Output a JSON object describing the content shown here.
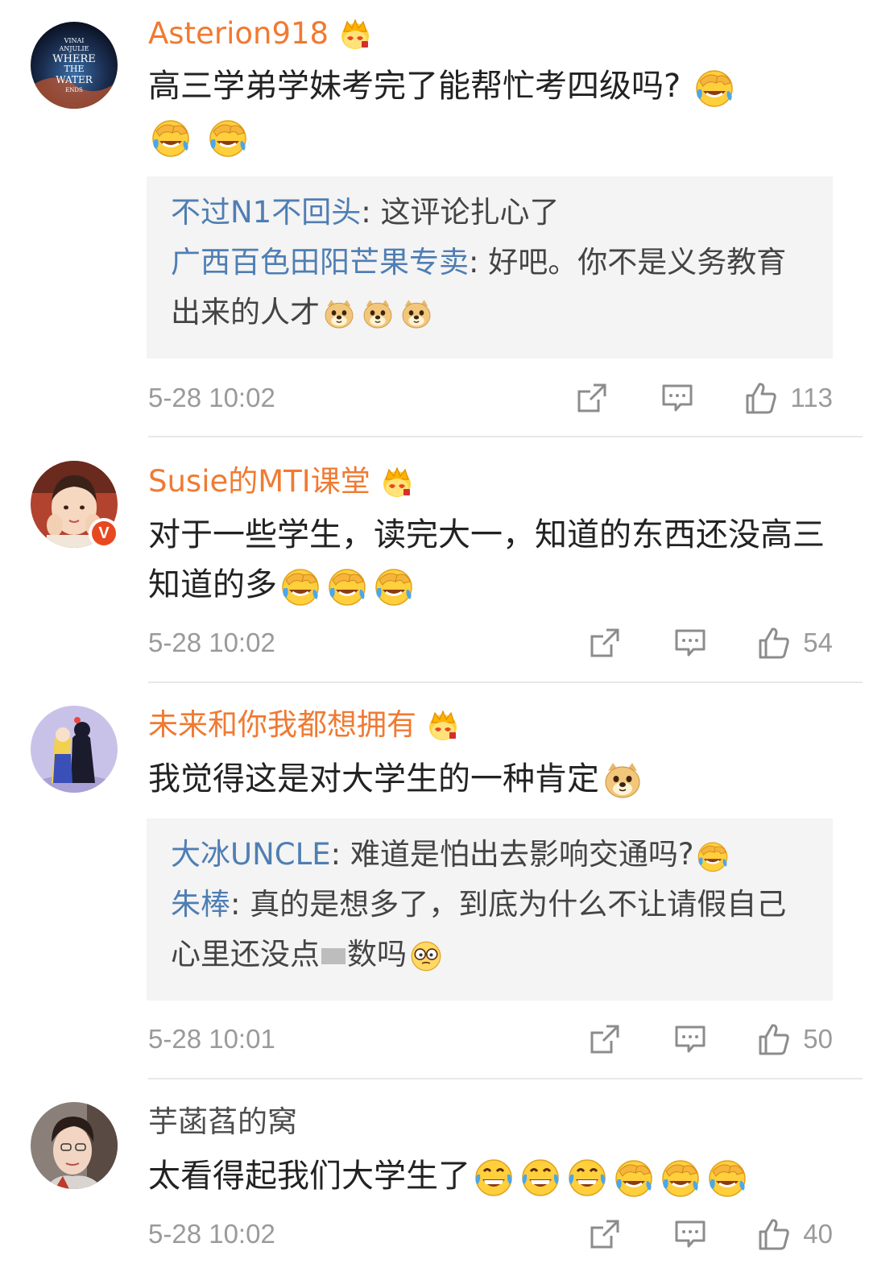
{
  "comments": [
    {
      "username": "Asterion918",
      "has_crown": true,
      "avatar_label": "vinai anjulie WHERE THE WATER ENDS",
      "text": "高三学弟学妹考完了能帮忙考四级吗?",
      "text_emojis": [
        "laugh-cry-emoji",
        "laugh-cry-emoji",
        "laugh-cry-emoji"
      ],
      "replies": [
        {
          "name": "不过N1不回头",
          "sep": ": ",
          "text": "这评论扎心了"
        },
        {
          "name": "广西百色田阳芒果专卖",
          "sep": ": ",
          "text": "好吧。你不是义务教育出来的人才"
        }
      ],
      "time": "5-28 10:02",
      "likes": "113"
    },
    {
      "username": "Susie的MTI课堂",
      "has_crown": true,
      "verified": true,
      "text": "对于一些学生，读完大一，知道的东西还没高三知道的多",
      "time": "5-28 10:02",
      "likes": "54"
    },
    {
      "username": "未来和你我都想拥有",
      "has_crown": true,
      "text": "我觉得这是对大学生的一种肯定",
      "replies": [
        {
          "name": "大冰UNCLE",
          "sep": ": ",
          "text": "难道是怕出去影响交通吗?"
        },
        {
          "name": "朱棒",
          "sep": ": ",
          "text_a": "真的是想多了，到底为什么不让请假自己心里还没点",
          "text_b": "数吗"
        }
      ],
      "time": "5-28 10:01",
      "likes": "50"
    },
    {
      "username": "芋菡萏的窝",
      "has_crown": false,
      "text": "太看得起我们大学生了",
      "time": "5-28 10:02",
      "likes": "40"
    }
  ],
  "colors": {
    "username": "#f07a32",
    "reply_name": "#4f7eb3",
    "meta": "#9a9a9a",
    "reply_bg": "#f4f4f4"
  }
}
